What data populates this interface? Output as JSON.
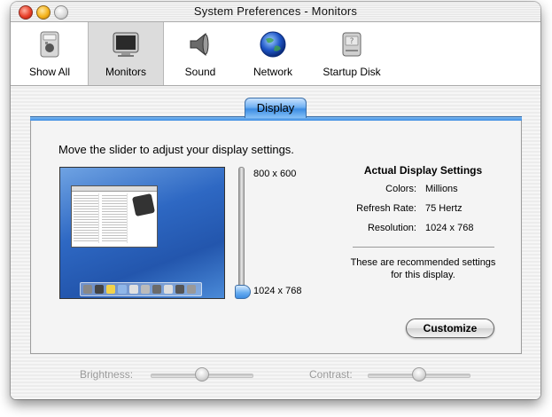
{
  "window": {
    "title": "System Preferences - Monitors"
  },
  "toolbar": {
    "items": [
      {
        "label": "Show All",
        "icon": "apple-switch-icon",
        "selected": false
      },
      {
        "label": "Monitors",
        "icon": "monitor-icon",
        "selected": true
      },
      {
        "label": "Sound",
        "icon": "speaker-icon",
        "selected": false
      },
      {
        "label": "Network",
        "icon": "globe-icon",
        "selected": false
      },
      {
        "label": "Startup Disk",
        "icon": "hard-disk-icon",
        "selected": false
      }
    ]
  },
  "tab": {
    "label": "Display"
  },
  "panel": {
    "instruction": "Move the slider to adjust your display settings.",
    "slider": {
      "top_label": "800 x 600",
      "bottom_label": "1024 x 768",
      "selected": "1024 x 768"
    },
    "settings": {
      "header": "Actual Display Settings",
      "rows": [
        {
          "key": "Colors:",
          "value": "Millions"
        },
        {
          "key": "Refresh Rate:",
          "value": "75 Hertz"
        },
        {
          "key": "Resolution:",
          "value": "1024 x 768"
        }
      ],
      "note": "These are recommended settings for this display."
    },
    "customize_label": "Customize"
  },
  "bottom": {
    "brightness_label": "Brightness:",
    "contrast_label": "Contrast:"
  },
  "colors": {
    "accent": "#3d8de3",
    "disabled_text": "#9a9a9a"
  }
}
